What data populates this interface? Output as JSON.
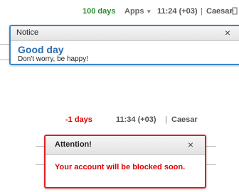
{
  "status_bar_top": {
    "days": "100 days",
    "apps": "Apps",
    "time": "11:24 (+03)",
    "separator": "|",
    "user": "Caesar",
    "days_color": "#2e8b2e"
  },
  "notice_popup": {
    "title": "Notice",
    "close": "×",
    "heading": "Good day",
    "message": "Don't worry, be happy!",
    "border_color": "#3a87c8"
  },
  "status_bar_bottom": {
    "days": "-1 days",
    "time": "11:34 (+03)",
    "separator": "|",
    "user": "Caesar",
    "days_color": "#e00000"
  },
  "attention_popup": {
    "title": "Attention!",
    "close": "×",
    "message": "Your account will be blocked soon.",
    "border_color": "#e01e1e"
  },
  "icons": {
    "apps_dropdown": "chevron-down-icon",
    "logout": "logout-icon"
  }
}
